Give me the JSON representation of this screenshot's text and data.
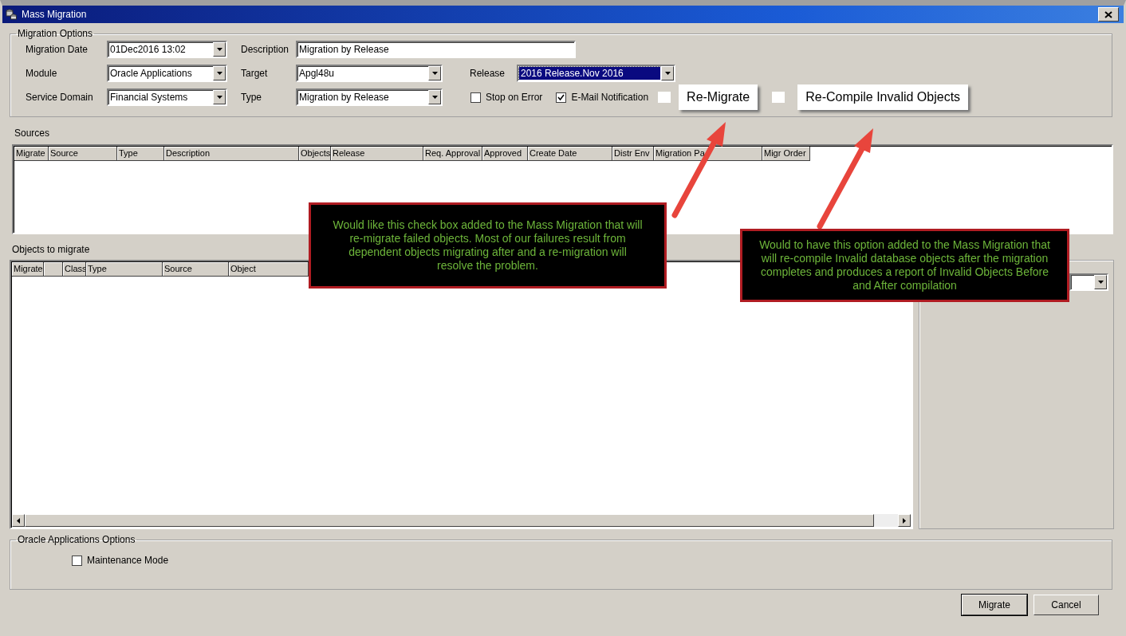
{
  "window": {
    "title": "Mass Migration"
  },
  "migration_options": {
    "title": "Migration Options",
    "migration_date": {
      "label": "Migration Date",
      "value": "01Dec2016 13:02"
    },
    "description": {
      "label": "Description",
      "value": "Migration by Release"
    },
    "module": {
      "label": "Module",
      "value": "Oracle Applications"
    },
    "target": {
      "label": "Target",
      "value": "Apgl48u"
    },
    "release": {
      "label": "Release",
      "value": "2016 Release.Nov 2016",
      "focused": true
    },
    "service_domain": {
      "label": "Service Domain",
      "value": "Financial Systems"
    },
    "type": {
      "label": "Type",
      "value": "Migration by Release"
    },
    "checkboxes": [
      {
        "label": "Stop on Error",
        "checked": false
      },
      {
        "label": "E-Mail Notification",
        "checked": true
      }
    ],
    "added_options": [
      {
        "label": "Re-Migrate",
        "checked": false
      },
      {
        "label": "Re-Compile Invalid Objects",
        "checked": false
      }
    ]
  },
  "sources": {
    "title": "Sources",
    "columns": [
      "Migrate",
      "Source",
      "Type",
      "Description",
      "Objects",
      "Release",
      "Req. Approval",
      "Approved",
      "Create Date",
      "Distr Env",
      "Migration Pa",
      "Migr Order"
    ]
  },
  "objects_to_migrate": {
    "title": "Objects to migrate",
    "columns": [
      "Migrate",
      "",
      "Class",
      "Type",
      "Source",
      "Object"
    ]
  },
  "oracle_applications_options": {
    "title": "Oracle Applications Options",
    "checkboxes": [
      {
        "label": "Maintenance Mode",
        "checked": false
      }
    ]
  },
  "buttons": [
    "Migrate",
    "Cancel"
  ],
  "callouts": [
    {
      "text": "Would like this check box added to the Mass Migration that will re-migrate failed objects.  Most of our failures result from dependent objects migrating after and a re-migration will resolve the problem."
    },
    {
      "text": "Would to have this option added to the Mass Migration that will re-compile Invalid database objects after the migration completes and produces a report of Invalid Objects Before and After compilation"
    }
  ]
}
